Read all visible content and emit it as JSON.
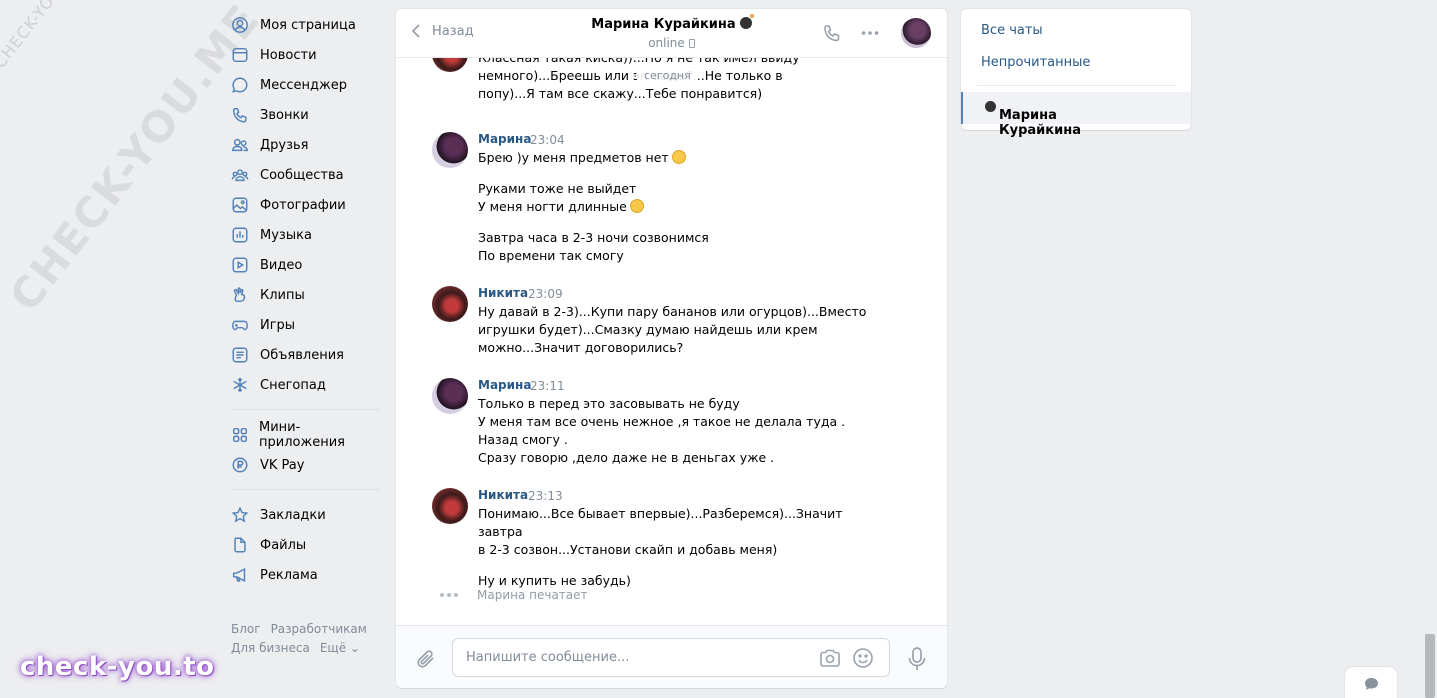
{
  "watermark": {
    "small": "CHECK-YOU.ME",
    "large": "CHECK-YOU.ME",
    "brand": "check-you.to"
  },
  "nav": {
    "items": [
      {
        "label": "Моя страница",
        "icon": "user-circle-icon"
      },
      {
        "label": "Новости",
        "icon": "news-icon"
      },
      {
        "label": "Мессенджер",
        "icon": "message-icon"
      },
      {
        "label": "Звонки",
        "icon": "phone-icon"
      },
      {
        "label": "Друзья",
        "icon": "friends-icon"
      },
      {
        "label": "Сообщества",
        "icon": "communities-icon"
      },
      {
        "label": "Фотографии",
        "icon": "photo-icon"
      },
      {
        "label": "Музыка",
        "icon": "music-icon"
      },
      {
        "label": "Видео",
        "icon": "video-icon"
      },
      {
        "label": "Клипы",
        "icon": "clips-icon"
      },
      {
        "label": "Игры",
        "icon": "gamepad-icon"
      },
      {
        "label": "Объявления",
        "icon": "ads-icon"
      },
      {
        "label": "Снегопад",
        "icon": "snowflake-icon"
      }
    ],
    "items2": [
      {
        "label": "Мини-приложения",
        "icon": "apps-icon"
      },
      {
        "label": "VK Pay",
        "icon": "vkpay-icon"
      }
    ],
    "items3": [
      {
        "label": "Закладки",
        "icon": "star-icon"
      },
      {
        "label": "Файлы",
        "icon": "file-icon"
      },
      {
        "label": "Реклама",
        "icon": "megaphone-icon"
      }
    ],
    "footer": {
      "blog": "Блог",
      "dev": "Разработчикам",
      "business": "Для бизнеса",
      "more": "Ещё ⌄"
    }
  },
  "chat": {
    "back_label": "Назад",
    "title": "Марина Курайкина",
    "status": "online",
    "date_pill": "сегодня",
    "messages": [
      {
        "author": "",
        "time": "",
        "paragraphs": [
          "Классная такая киска))...Но я не так имел ввиду\nнемного)...Бреешь или эп         аешь?...Не только в\nпопу)...Я там все скажу...Тебе понравится)"
        ]
      },
      {
        "author": "Марина",
        "time": "23:04",
        "paragraphs": [
          "Брею )у меня предметов нет",
          "Руками тоже не выйдет\nУ меня ногти длинные",
          "Завтра часа в 2-3 ночи созвонимся\nПо времени так смогу"
        ]
      },
      {
        "author": "Никита",
        "time": "23:09",
        "paragraphs": [
          "Ну давай в 2-3)...Купи пару бананов или огурцов)...Вместо\nигрушки будет)...Смазку думаю найдешь или крем\nможно...Значит договорились?"
        ]
      },
      {
        "author": "Марина",
        "time": "23:11",
        "paragraphs": [
          "Только в перед это засовывать не буду\nУ меня там все очень нежное ,я такое не делала туда .\nНазад смогу .\nСразу говорю ,дело даже не в деньгах уже ."
        ]
      },
      {
        "author": "Никита",
        "time": "23:13",
        "paragraphs": [
          "Понимаю...Все бывает впервые)...Разберемся)...Значит завтра\nв 2-3 созвон...Установи скайп и добавь меня)",
          "Ну и купить не забудь)"
        ]
      }
    ],
    "typing": "Марина печатает",
    "composer_placeholder": "Напишите сообщение..."
  },
  "right_panel": {
    "all_chats": "Все чаты",
    "unread": "Непрочитанные",
    "active_chat": "Марина Курайкина"
  },
  "colors": {
    "link": "#2a5885",
    "accent": "#5181b8",
    "background": "#edeef0"
  }
}
